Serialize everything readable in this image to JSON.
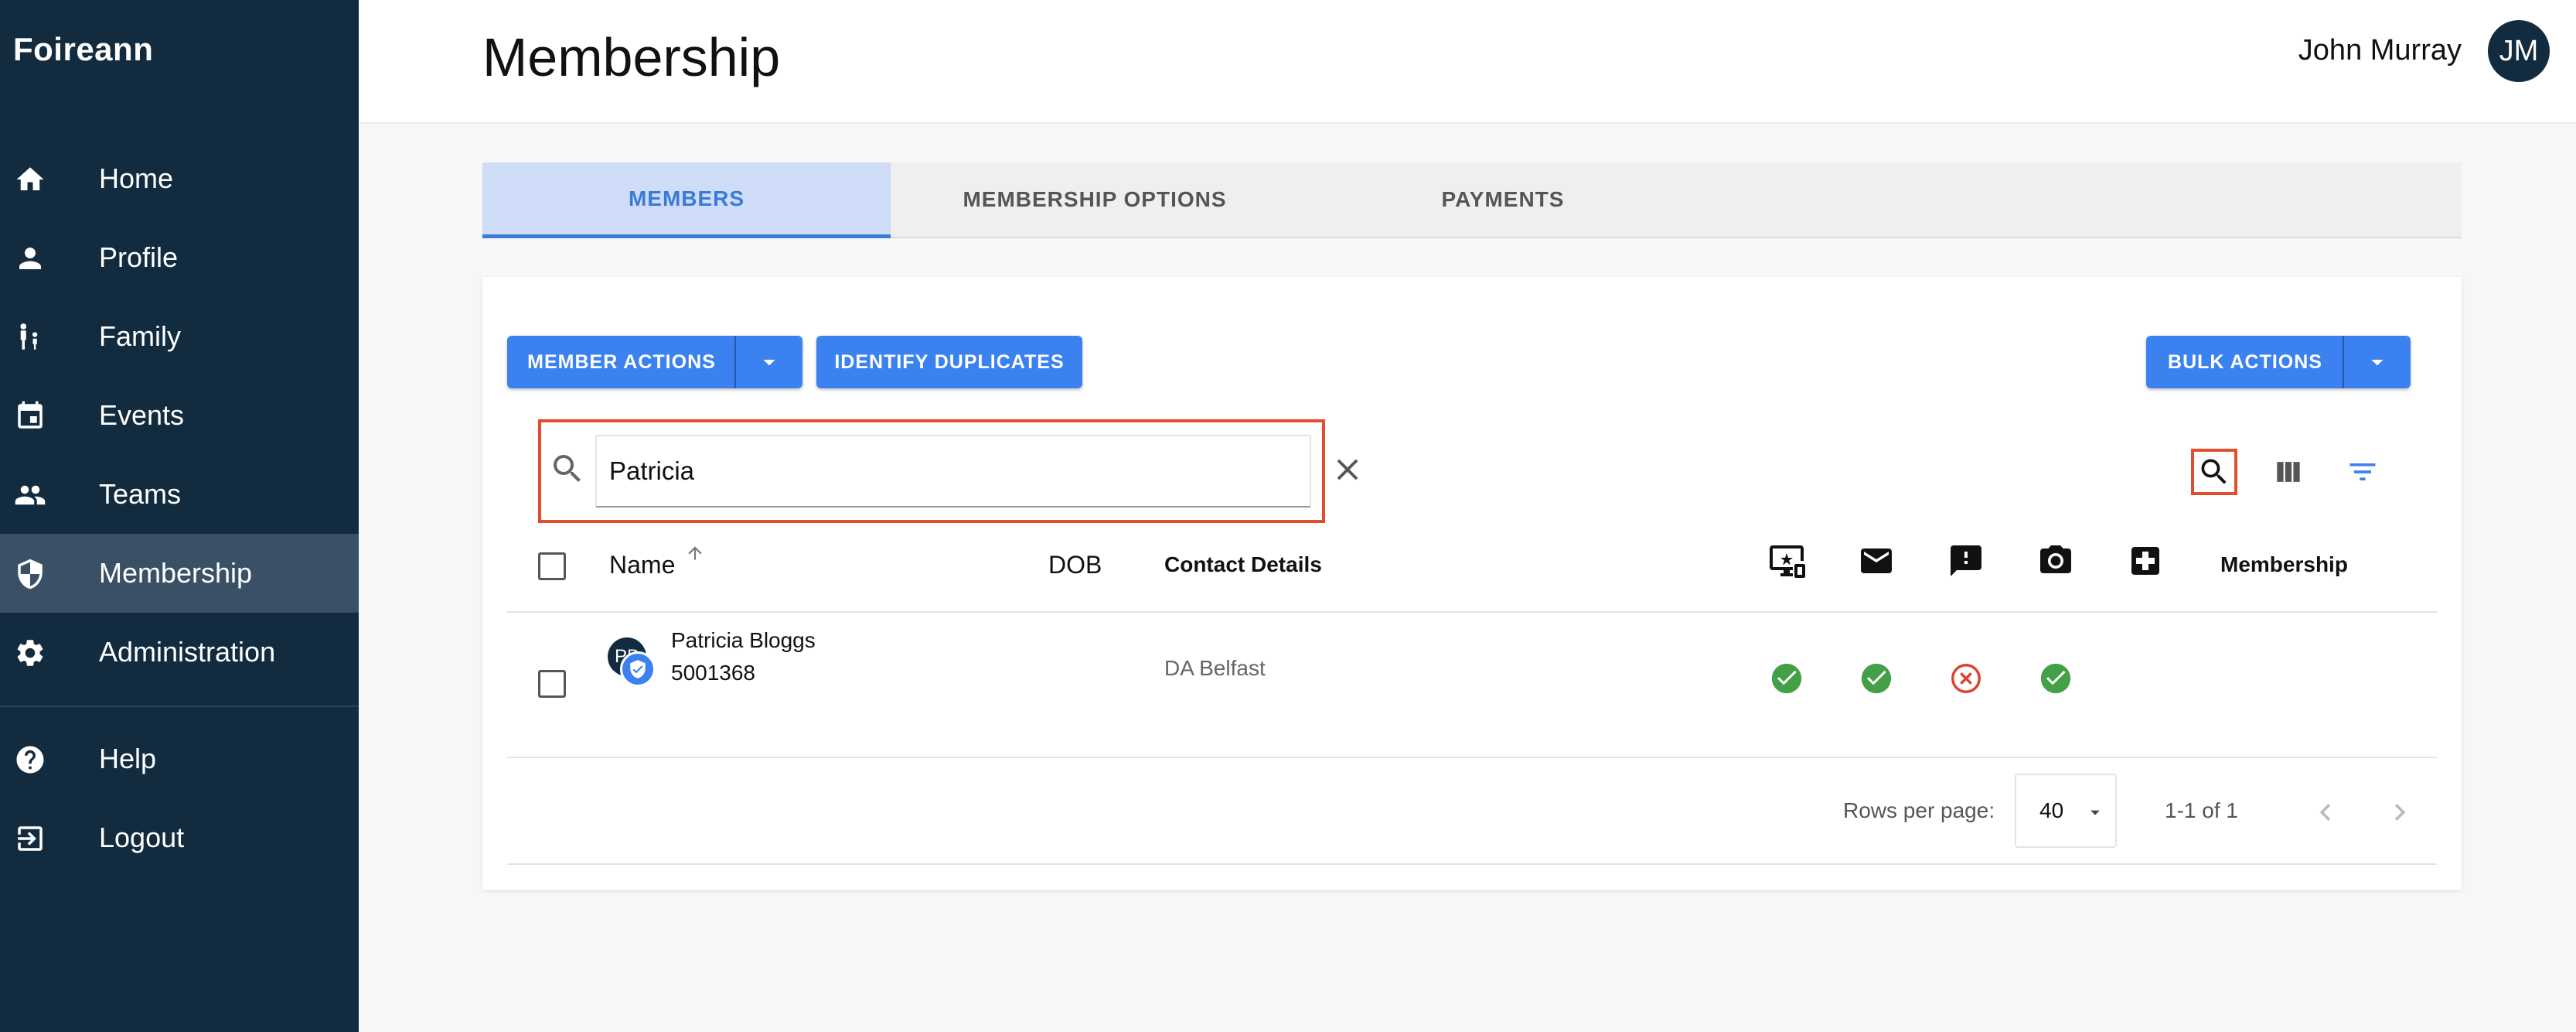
{
  "app": {
    "brand": "Foireann"
  },
  "sidebar": {
    "items": [
      {
        "label": "Home",
        "icon": "home-icon"
      },
      {
        "label": "Profile",
        "icon": "person-icon"
      },
      {
        "label": "Family",
        "icon": "family-icon"
      },
      {
        "label": "Events",
        "icon": "calendar-icon"
      },
      {
        "label": "Teams",
        "icon": "group-icon"
      },
      {
        "label": "Membership",
        "icon": "shield-icon",
        "active": true
      },
      {
        "label": "Administration",
        "icon": "gear-icon"
      }
    ],
    "bottom_items": [
      {
        "label": "Help",
        "icon": "help-icon"
      },
      {
        "label": "Logout",
        "icon": "logout-icon"
      }
    ]
  },
  "header": {
    "title": "Membership",
    "user_name": "John Murray",
    "avatar_initials": "JM"
  },
  "tabs": [
    {
      "label": "MEMBERS",
      "active": true
    },
    {
      "label": "MEMBERSHIP OPTIONS"
    },
    {
      "label": "PAYMENTS"
    }
  ],
  "toolbar": {
    "member_actions": "MEMBER ACTIONS",
    "identify_duplicates": "IDENTIFY DUPLICATES",
    "bulk_actions": "BULK ACTIONS"
  },
  "search": {
    "value": "Patricia",
    "placeholder": ""
  },
  "table": {
    "headers": {
      "name": "Name",
      "dob": "DOB",
      "contact": "Contact Details",
      "membership": "Membership"
    },
    "icon_columns": [
      "devices-star-icon",
      "mail-icon",
      "alert-message-icon",
      "camera-icon",
      "medical-plus-icon"
    ],
    "rows": [
      {
        "avatar_initials": "PB",
        "name": "Patricia Bloggs",
        "member_id": "5001368",
        "dob": "",
        "contact": "DA Belfast",
        "statuses": [
          "check",
          "check",
          "cross",
          "check",
          ""
        ]
      }
    ]
  },
  "pagination": {
    "rows_per_page_label": "Rows per page:",
    "rows_per_page": "40",
    "range": "1-1 of 1"
  },
  "colors": {
    "sidebar_bg": "#122b3f",
    "accent": "#3b82f0",
    "success": "#43a047",
    "error": "#d9432f",
    "highlight": "#e24d2d"
  }
}
